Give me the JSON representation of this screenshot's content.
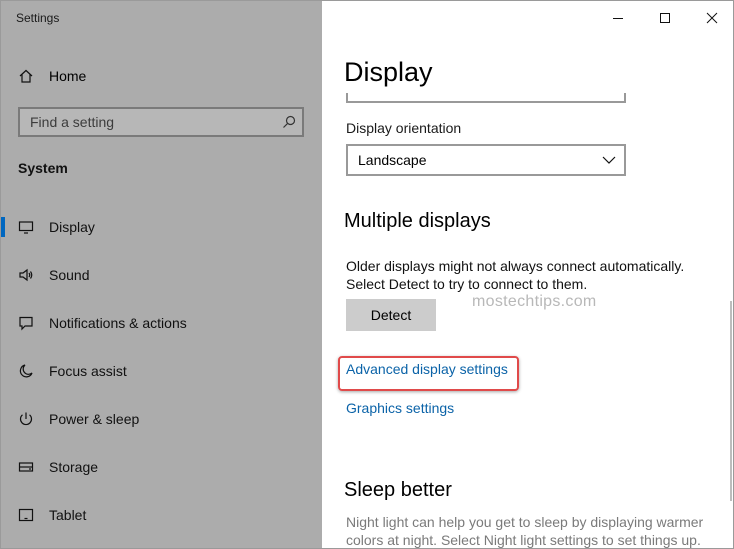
{
  "window": {
    "app_title": "Settings"
  },
  "sidebar": {
    "home_label": "Home",
    "search_placeholder": "Find a setting",
    "section_title": "System",
    "items": [
      {
        "label": "Display",
        "icon": "monitor-icon",
        "active": true
      },
      {
        "label": "Sound",
        "icon": "speaker-icon"
      },
      {
        "label": "Notifications & actions",
        "icon": "notification-icon"
      },
      {
        "label": "Focus assist",
        "icon": "moon-icon"
      },
      {
        "label": "Power & sleep",
        "icon": "power-icon"
      },
      {
        "label": "Storage",
        "icon": "storage-icon"
      },
      {
        "label": "Tablet",
        "icon": "tablet-icon"
      }
    ]
  },
  "main": {
    "page_title": "Display",
    "orientation_label": "Display orientation",
    "orientation_value": "Landscape",
    "multiple_displays_heading": "Multiple displays",
    "multiple_displays_text": "Older displays might not always connect automatically. Select Detect to try to connect to them.",
    "detect_label": "Detect",
    "watermark": "mostechtips.com",
    "advanced_link": "Advanced display settings",
    "graphics_link": "Graphics settings",
    "sleep_heading": "Sleep better",
    "sleep_text": "Night light can help you get to sleep by displaying warmer colors at night. Select Night light settings to set things up."
  },
  "colors": {
    "accent": "#0067c0",
    "link": "#0b63a8",
    "highlight": "#e04a4a"
  }
}
